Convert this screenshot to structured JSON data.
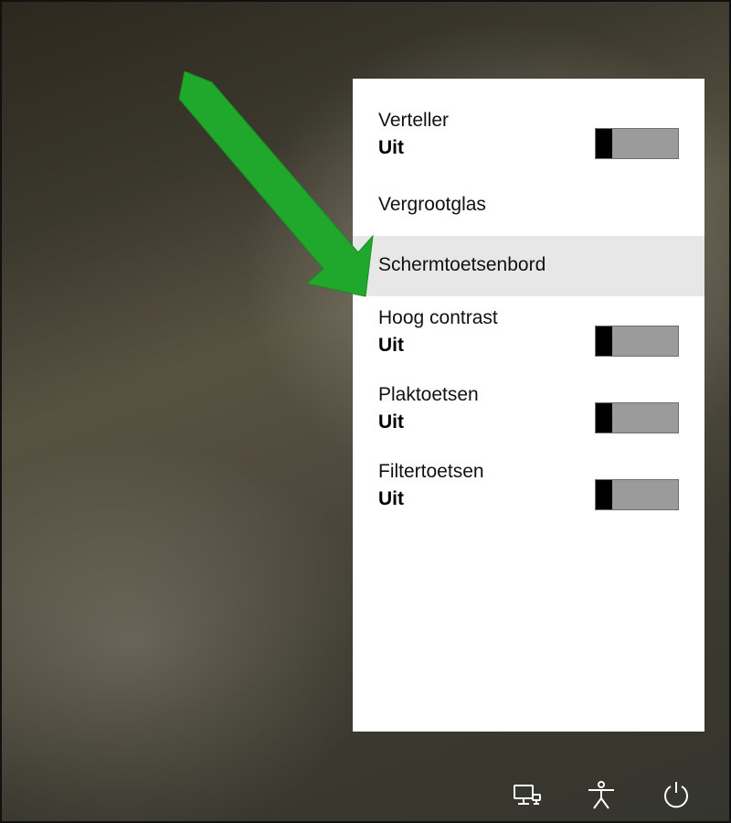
{
  "state_labels": {
    "off": "Uit"
  },
  "menu": {
    "items": [
      {
        "label": "Verteller",
        "state_key": "off",
        "has_toggle": true,
        "highlight": false
      },
      {
        "label": "Vergrootglas",
        "state_key": null,
        "has_toggle": false,
        "highlight": false
      },
      {
        "label": "Schermtoetsenbord",
        "state_key": null,
        "has_toggle": false,
        "highlight": true
      },
      {
        "label": "Hoog contrast",
        "state_key": "off",
        "has_toggle": true,
        "highlight": false
      },
      {
        "label": "Plaktoetsen",
        "state_key": "off",
        "has_toggle": true,
        "highlight": false
      },
      {
        "label": "Filtertoetsen",
        "state_key": "off",
        "has_toggle": true,
        "highlight": false
      }
    ]
  },
  "bottom_icons": {
    "network": "network-icon",
    "accessibility": "accessibility-icon",
    "power": "power-icon"
  }
}
